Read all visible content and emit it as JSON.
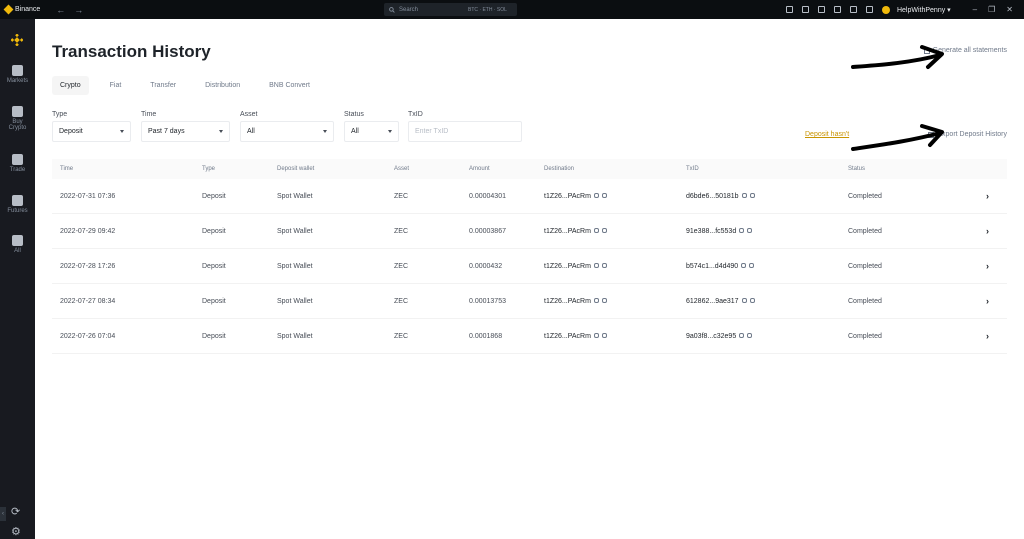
{
  "titlebar": {
    "app_name": "Binance",
    "back": "←",
    "forward": "→",
    "search_placeholder": "Search",
    "search_tags": "BTC · ETH · SOL",
    "username": "HelpWithPenny ▾",
    "minimize": "–",
    "restore": "❐",
    "close": "✕"
  },
  "sidebar": {
    "items": [
      {
        "label": "Markets"
      },
      {
        "label": "Buy Crypto"
      },
      {
        "label": "Trade"
      },
      {
        "label": "Futures"
      },
      {
        "label": "All"
      }
    ],
    "collapse": "‹",
    "refresh": "⟳",
    "settings": "⚙"
  },
  "page": {
    "title": "Transaction History",
    "generate_link": "Generate all statements",
    "tabs": [
      "Crypto",
      "Fiat",
      "Transfer",
      "Distribution",
      "BNB Convert"
    ],
    "filters": {
      "type": {
        "label": "Type",
        "value": "Deposit"
      },
      "time": {
        "label": "Time",
        "value": "Past 7 days"
      },
      "asset": {
        "label": "Asset",
        "value": "All"
      },
      "status": {
        "label": "Status",
        "value": "All"
      },
      "txid": {
        "label": "TxID",
        "placeholder": "Enter TxID"
      }
    },
    "deposit_link": "Deposit hasn't",
    "export_link": "Export Deposit History"
  },
  "table": {
    "headers": [
      "Time",
      "Type",
      "Deposit wallet",
      "Asset",
      "Amount",
      "Destination",
      "TxID",
      "Status"
    ],
    "rows": [
      {
        "time": "2022-07-31 07:36",
        "type": "Deposit",
        "wallet": "Spot Wallet",
        "asset": "ZEC",
        "amount": "0.00004301",
        "destination": "t1Z26...PAcRm",
        "txid": "d6bde6...50181b",
        "status": "Completed"
      },
      {
        "time": "2022-07-29 09:42",
        "type": "Deposit",
        "wallet": "Spot Wallet",
        "asset": "ZEC",
        "amount": "0.00003867",
        "destination": "t1Z26...PAcRm",
        "txid": "91e388...fc553d",
        "status": "Completed"
      },
      {
        "time": "2022-07-28 17:26",
        "type": "Deposit",
        "wallet": "Spot Wallet",
        "asset": "ZEC",
        "amount": "0.0000432",
        "destination": "t1Z26...PAcRm",
        "txid": "b574c1...d4d490",
        "status": "Completed"
      },
      {
        "time": "2022-07-27 08:34",
        "type": "Deposit",
        "wallet": "Spot Wallet",
        "asset": "ZEC",
        "amount": "0.00013753",
        "destination": "t1Z26...PAcRm",
        "txid": "612862...9ae317",
        "status": "Completed"
      },
      {
        "time": "2022-07-26 07:04",
        "type": "Deposit",
        "wallet": "Spot Wallet",
        "asset": "ZEC",
        "amount": "0.0001868",
        "destination": "t1Z26...PAcRm",
        "txid": "9a03f8...c32e95",
        "status": "Completed"
      }
    ],
    "row_arrow": "›"
  },
  "colors": {
    "brand": "#f0b90b",
    "titlebar_bg": "#0b0e11",
    "sidebar_bg": "#181a20",
    "link_gold": "#c99400"
  }
}
